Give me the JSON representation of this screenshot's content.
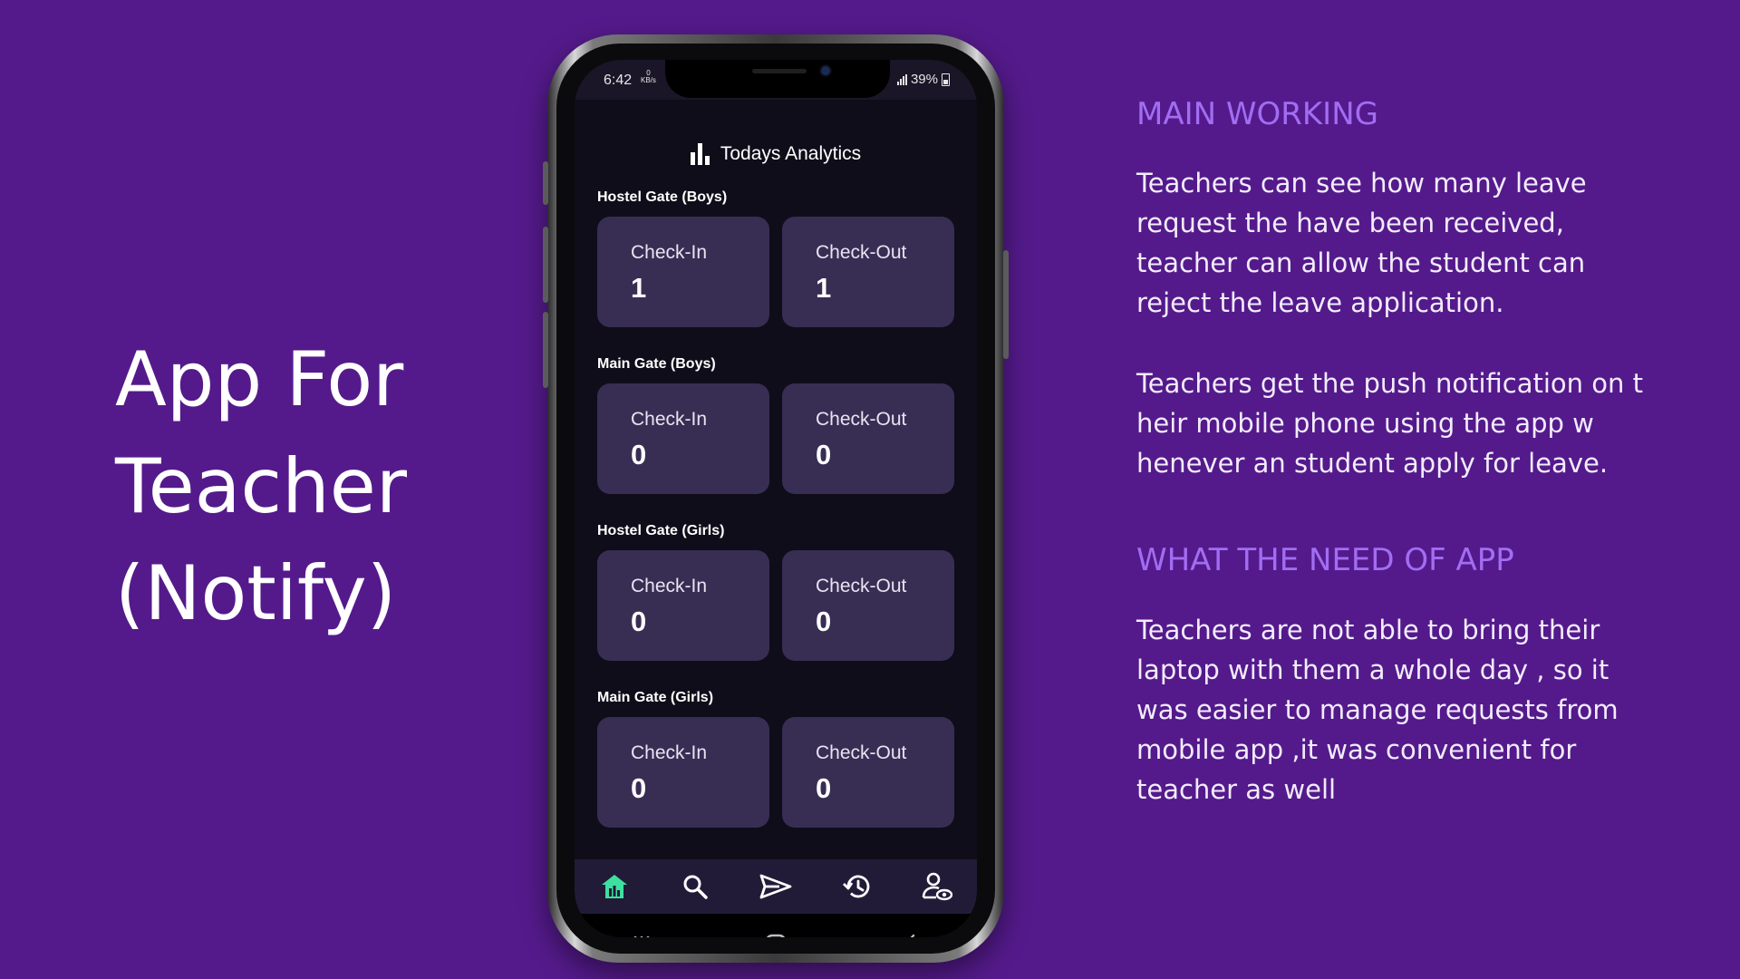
{
  "hero": {
    "lines": [
      "App For",
      "Teacher",
      "(Notify)"
    ]
  },
  "status_bar": {
    "time": "6:42",
    "net_top": "0",
    "net_bottom": "KB/s",
    "battery": "39%"
  },
  "app": {
    "title": "Todays Analytics",
    "title_icon": "bar-chart-icon",
    "gates": [
      {
        "label": "Hostel Gate (Boys)",
        "checkin_label": "Check-In",
        "checkin_value": "1",
        "checkout_label": "Check-Out",
        "checkout_value": "1"
      },
      {
        "label": "Main Gate (Boys)",
        "checkin_label": "Check-In",
        "checkin_value": "0",
        "checkout_label": "Check-Out",
        "checkout_value": "0"
      },
      {
        "label": "Hostel Gate (Girls)",
        "checkin_label": "Check-In",
        "checkin_value": "0",
        "checkout_label": "Check-Out",
        "checkout_value": "0"
      },
      {
        "label": "Main Gate (Girls)",
        "checkin_label": "Check-In",
        "checkin_value": "0",
        "checkout_label": "Check-Out",
        "checkout_value": "0"
      }
    ],
    "bottom_nav": [
      {
        "icon": "home-icon",
        "active": true
      },
      {
        "icon": "search-icon",
        "active": false
      },
      {
        "icon": "send-icon",
        "active": false
      },
      {
        "icon": "history-icon",
        "active": false
      },
      {
        "icon": "user-view-icon",
        "active": false
      }
    ],
    "system_nav": [
      "recent-apps-icon",
      "home-square-icon",
      "back-icon"
    ]
  },
  "right": {
    "heading_main": "MAIN WORKING",
    "para1_lines": [
      "Teachers can see how many leave",
      "request the have been received,",
      "teacher can allow the student can",
      "reject the leave application."
    ],
    "para2_lines": [
      "Teachers get the push notification on t",
      "heir mobile phone using the app w",
      "henever an student apply for leave."
    ],
    "heading_need": "WHAT THE NEED OF APP",
    "para3_lines": [
      "Teachers are not able to bring their",
      "laptop with them a whole day , so it",
      "was easier to manage requests from",
      "mobile app ,it was convenient for",
      "teacher as well"
    ]
  },
  "colors": {
    "background": "#541a8b",
    "heading": "#a16df2",
    "card": "#382e54",
    "nav_active": "#3ee0a0"
  }
}
